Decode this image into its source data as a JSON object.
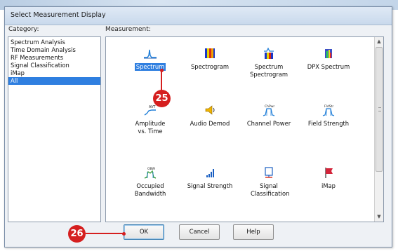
{
  "dialog": {
    "title": "Select Measurement Display",
    "category_label": "Category:",
    "measurement_label": "Measurement:"
  },
  "categories": [
    {
      "label": "Spectrum Analysis",
      "selected": false
    },
    {
      "label": "Time Domain Analysis",
      "selected": false
    },
    {
      "label": "RF Measurements",
      "selected": false
    },
    {
      "label": "Signal Classification",
      "selected": false
    },
    {
      "label": "iMap",
      "selected": false
    },
    {
      "label": "All",
      "selected": true
    }
  ],
  "measurements": [
    {
      "label": "Spectrum",
      "icon": "spectrum-icon",
      "selected": true
    },
    {
      "label": "Spectrogram",
      "icon": "spectrogram-icon",
      "selected": false
    },
    {
      "label": "Spectrum Spectrogram",
      "icon": "spectrum-spectrogram-icon",
      "selected": false
    },
    {
      "label": "DPX Spectrum",
      "icon": "dpx-spectrum-icon",
      "selected": false
    },
    {
      "label": "Amplitude vs. Time",
      "icon": "amplitude-vs-time-icon",
      "selected": false
    },
    {
      "label": "Audio Demod",
      "icon": "speaker-icon",
      "selected": false
    },
    {
      "label": "Channel Power",
      "icon": "channel-power-icon",
      "selected": false
    },
    {
      "label": "Field Strength",
      "icon": "field-strength-icon",
      "selected": false
    },
    {
      "label": "Occupied Bandwidth",
      "icon": "occupied-bandwidth-icon",
      "selected": false
    },
    {
      "label": "Signal Strength",
      "icon": "signal-strength-icon",
      "selected": false
    },
    {
      "label": "Signal Classification",
      "icon": "signal-classification-icon",
      "selected": false
    },
    {
      "label": "iMap",
      "icon": "imap-flag-icon",
      "selected": false
    }
  ],
  "icon_text": {
    "amplitude": "AVT",
    "channel_power": "ChPwr",
    "field_strength": "FldStr",
    "occupied_bw": "OBW"
  },
  "buttons": {
    "ok": "OK",
    "cancel": "Cancel",
    "help": "Help"
  },
  "callouts": {
    "spectrum": "25",
    "ok": "26"
  },
  "colors": {
    "selection": "#2f7fe0",
    "callout": "#d51f1f"
  }
}
